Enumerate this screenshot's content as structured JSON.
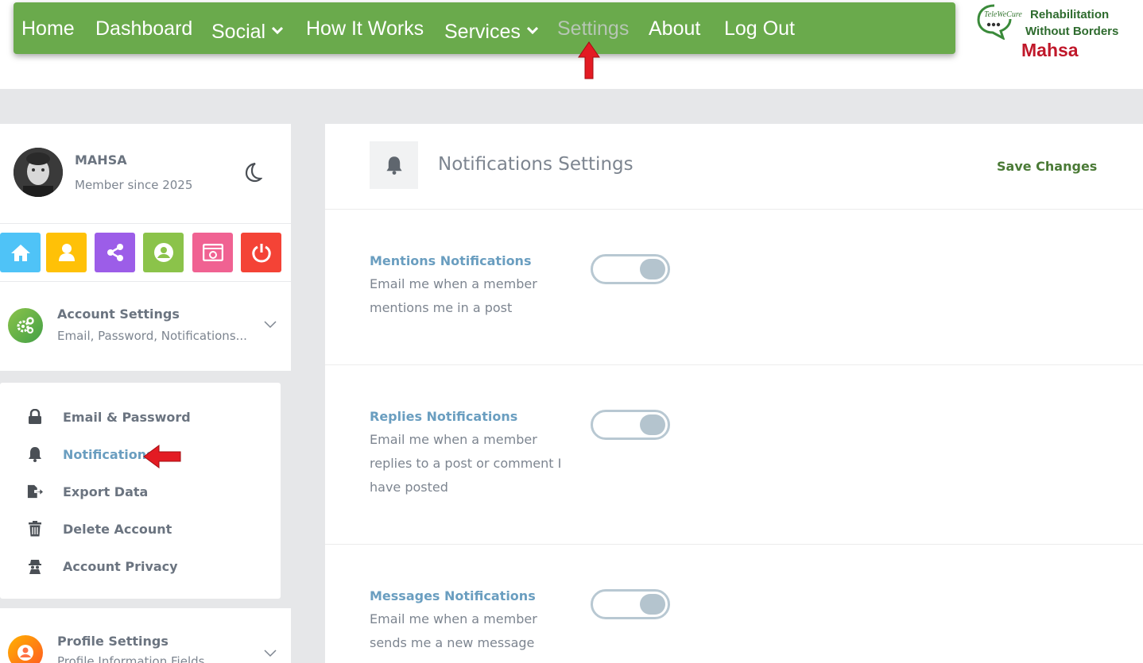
{
  "nav": {
    "items": [
      "Home",
      "Dashboard",
      "Social",
      "How It Works",
      "Services",
      "Settings",
      "About",
      "Log Out"
    ]
  },
  "logo": {
    "small": "TeleWeCure",
    "line1": "Rehabilitation",
    "line2": "Without Borders",
    "username": "Mahsa"
  },
  "profile": {
    "name": "MAHSA",
    "member_since": "Member since 2025"
  },
  "quick_links": [
    {
      "icon": "home-icon",
      "color": "#4fc3f7"
    },
    {
      "icon": "user-icon",
      "color": "#ffc107"
    },
    {
      "icon": "share-icon",
      "color": "#9c5de8"
    },
    {
      "icon": "account-circle-icon",
      "color": "#8bc34a"
    },
    {
      "icon": "media-icon",
      "color": "#f06292"
    },
    {
      "icon": "power-icon",
      "color": "#f44336"
    }
  ],
  "account_settings": {
    "title": "Account Settings",
    "subtitle": "Email, Password, Notifications..."
  },
  "submenu": [
    {
      "label": "Email & Password",
      "icon": "lock-icon"
    },
    {
      "label": "Notifications",
      "icon": "bell-icon",
      "active": true
    },
    {
      "label": "Export Data",
      "icon": "export-icon"
    },
    {
      "label": "Delete Account",
      "icon": "trash-icon"
    },
    {
      "label": "Account Privacy",
      "icon": "privacy-icon"
    }
  ],
  "profile_settings": {
    "title": "Profile Settings",
    "subtitle": "Profile Information Fields"
  },
  "panel": {
    "title": "Notifications Settings",
    "save_label": "Save Changes"
  },
  "settings": [
    {
      "title": "Mentions Notifications",
      "description": "Email me when a member mentions me in a post",
      "enabled": true
    },
    {
      "title": "Replies Notifications",
      "description": "Email me when a member replies to a post or comment I have posted",
      "enabled": true
    },
    {
      "title": "Messages Notifications",
      "description": "Email me when a member sends me a new message",
      "enabled": true
    }
  ],
  "colors": {
    "nav_bg": "#6aaa4c",
    "active_blue": "#6a9ec0",
    "save_green": "#4a7a36",
    "annotation_red": "#e31b23"
  }
}
